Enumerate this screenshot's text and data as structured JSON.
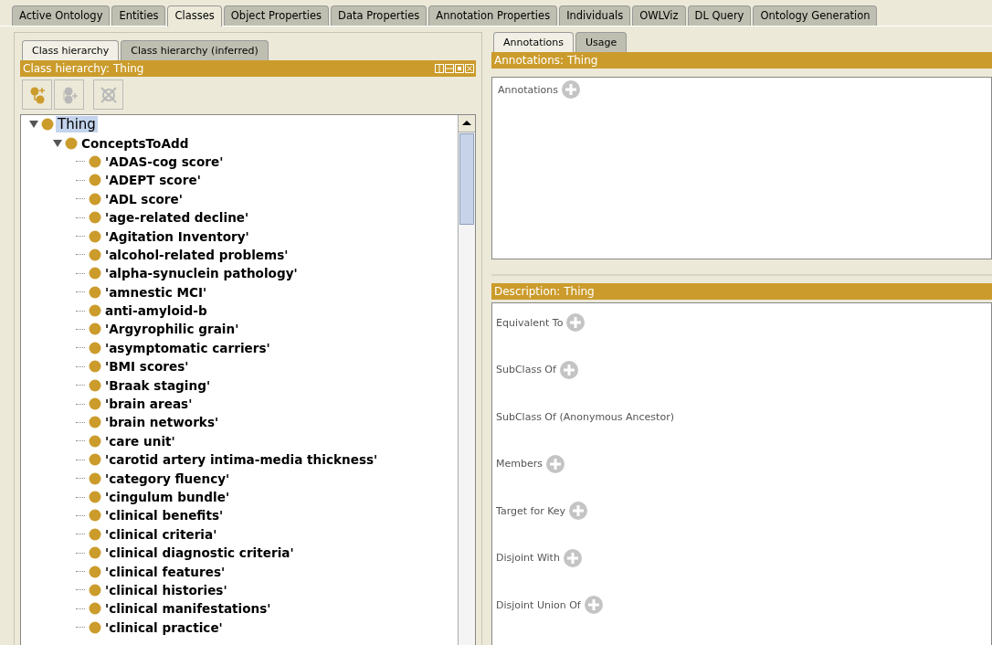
{
  "main_tabs": [
    {
      "label": "Active Ontology",
      "selected": false
    },
    {
      "label": "Entities",
      "selected": false
    },
    {
      "label": "Classes",
      "selected": true
    },
    {
      "label": "Object Properties",
      "selected": false
    },
    {
      "label": "Data Properties",
      "selected": false
    },
    {
      "label": "Annotation Properties",
      "selected": false
    },
    {
      "label": "Individuals",
      "selected": false
    },
    {
      "label": "OWLViz",
      "selected": false
    },
    {
      "label": "DL Query",
      "selected": false
    },
    {
      "label": "Ontology Generation",
      "selected": false
    }
  ],
  "left": {
    "tabs": [
      {
        "label": "Class hierarchy",
        "selected": true
      },
      {
        "label": "Class hierarchy (inferred)",
        "selected": false
      }
    ],
    "header": "Class hierarchy: Thing",
    "toolbar": [
      {
        "kind": "add-subclass",
        "disabled": false
      },
      {
        "kind": "add-sibling",
        "disabled": true
      },
      {
        "kind": "delete",
        "disabled": true
      }
    ],
    "tree": [
      {
        "label": "Thing",
        "bold": false,
        "selected": true,
        "expanded": true,
        "children": [
          {
            "label": "ConceptsToAdd",
            "bold": true,
            "selected": false,
            "expanded": true,
            "children": [
              {
                "label": "'ADAS-cog score'",
                "bold": true,
                "selected": false
              },
              {
                "label": "'ADEPT score'",
                "bold": true,
                "selected": false
              },
              {
                "label": "'ADL score'",
                "bold": true,
                "selected": false
              },
              {
                "label": "'age-related decline'",
                "bold": true,
                "selected": false
              },
              {
                "label": "'Agitation Inventory'",
                "bold": true,
                "selected": false
              },
              {
                "label": "'alcohol-related problems'",
                "bold": true,
                "selected": false
              },
              {
                "label": "'alpha-synuclein pathology'",
                "bold": true,
                "selected": false
              },
              {
                "label": "'amnestic MCI'",
                "bold": true,
                "selected": false
              },
              {
                "label": "anti-amyloid-b",
                "bold": true,
                "selected": false
              },
              {
                "label": "'Argyrophilic grain'",
                "bold": true,
                "selected": false
              },
              {
                "label": "'asymptomatic carriers'",
                "bold": true,
                "selected": false
              },
              {
                "label": "'BMI scores'",
                "bold": true,
                "selected": false
              },
              {
                "label": "'Braak staging'",
                "bold": true,
                "selected": false
              },
              {
                "label": "'brain areas'",
                "bold": true,
                "selected": false
              },
              {
                "label": "'brain networks'",
                "bold": true,
                "selected": false
              },
              {
                "label": "'care unit'",
                "bold": true,
                "selected": false
              },
              {
                "label": "'carotid artery intima-media thickness'",
                "bold": true,
                "selected": false
              },
              {
                "label": "'category fluency'",
                "bold": true,
                "selected": false
              },
              {
                "label": "'cingulum bundle'",
                "bold": true,
                "selected": false
              },
              {
                "label": "'clinical benefits'",
                "bold": true,
                "selected": false
              },
              {
                "label": "'clinical criteria'",
                "bold": true,
                "selected": false
              },
              {
                "label": "'clinical diagnostic criteria'",
                "bold": true,
                "selected": false
              },
              {
                "label": "'clinical features'",
                "bold": true,
                "selected": false
              },
              {
                "label": "'clinical histories'",
                "bold": true,
                "selected": false
              },
              {
                "label": "'clinical manifestations'",
                "bold": true,
                "selected": false
              },
              {
                "label": "'clinical practice'",
                "bold": true,
                "selected": false
              }
            ]
          }
        ]
      }
    ]
  },
  "right": {
    "tabs": [
      {
        "label": "Annotations",
        "selected": true
      },
      {
        "label": "Usage",
        "selected": false
      }
    ],
    "annotations_header": "Annotations: Thing",
    "annotations_label": "Annotations",
    "description_header": "Description: Thing",
    "description_sections": [
      {
        "label": "Equivalent To",
        "addable": true
      },
      {
        "label": "SubClass Of",
        "addable": true
      },
      {
        "label": "SubClass Of (Anonymous Ancestor)",
        "addable": false
      },
      {
        "label": "Members",
        "addable": true
      },
      {
        "label": "Target for Key",
        "addable": true
      },
      {
        "label": "Disjoint With",
        "addable": true
      },
      {
        "label": "Disjoint Union Of",
        "addable": true
      }
    ]
  }
}
